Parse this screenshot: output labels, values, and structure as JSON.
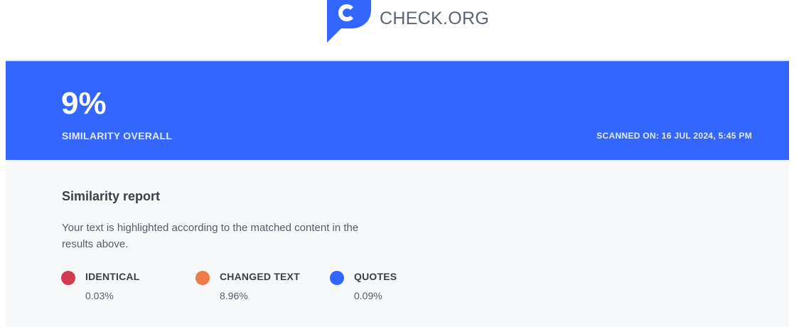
{
  "header": {
    "logo_text": "CHECK.ORG"
  },
  "banner": {
    "similarity_percent": "9%",
    "overall_label": "SIMILARITY OVERALL",
    "scanned_on": "SCANNED ON: 16 JUL 2024, 5:45 PM",
    "background_color": "#3366ff"
  },
  "report": {
    "title": "Similarity report",
    "description": "Your text is highlighted according to the matched content in the results above.",
    "legend": [
      {
        "label": "IDENTICAL",
        "value": "0.03%",
        "color": "#d23a50"
      },
      {
        "label": "CHANGED TEXT",
        "value": "8.96%",
        "color": "#f07a48"
      },
      {
        "label": "QUOTES",
        "value": "0.09%",
        "color": "#3366ff"
      }
    ]
  }
}
